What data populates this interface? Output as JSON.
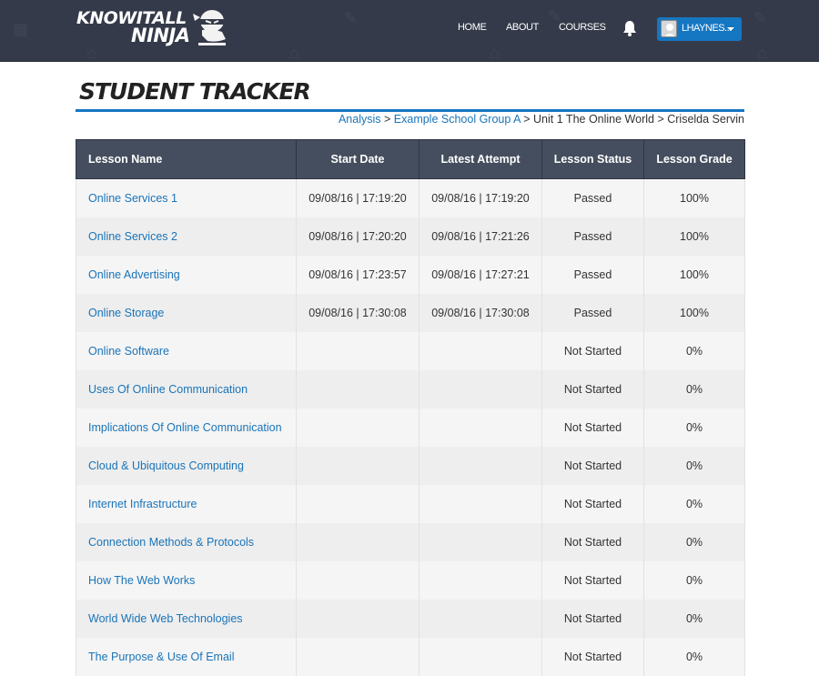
{
  "header": {
    "logo": {
      "line1": "KNOWITALL",
      "line2": "NINJA"
    },
    "nav": [
      {
        "label": "HOME"
      },
      {
        "label": "ABOUT"
      },
      {
        "label": "COURSES"
      }
    ],
    "notifications_icon": "bell-icon",
    "user": {
      "name": "LHAYNES...",
      "avatar_icon": "user-avatar-icon"
    },
    "colors": {
      "bar": "#343a49",
      "accent": "#1576c2"
    }
  },
  "page": {
    "title": "STUDENT TRACKER"
  },
  "breadcrumb": {
    "items": [
      {
        "label": "Analysis",
        "link": true
      },
      {
        "label": "Example School Group A",
        "link": true
      },
      {
        "label": "Unit 1 The Online World",
        "link": false
      },
      {
        "label": "Criselda Servin",
        "link": false
      }
    ],
    "separator": ">"
  },
  "table": {
    "columns": [
      "Lesson Name",
      "Start Date",
      "Latest Attempt",
      "Lesson Status",
      "Lesson Grade"
    ],
    "rows": [
      {
        "lesson": "Online Services 1",
        "start": "09/08/16 | 17:19:20",
        "latest": "09/08/16 | 17:19:20",
        "status": "Passed",
        "grade": "100%"
      },
      {
        "lesson": "Online Services 2",
        "start": "09/08/16 | 17:20:20",
        "latest": "09/08/16 | 17:21:26",
        "status": "Passed",
        "grade": "100%"
      },
      {
        "lesson": "Online Advertising",
        "start": "09/08/16 | 17:23:57",
        "latest": "09/08/16 | 17:27:21",
        "status": "Passed",
        "grade": "100%"
      },
      {
        "lesson": "Online Storage",
        "start": "09/08/16 | 17:30:08",
        "latest": "09/08/16 | 17:30:08",
        "status": "Passed",
        "grade": "100%"
      },
      {
        "lesson": "Online Software",
        "start": "",
        "latest": "",
        "status": "Not Started",
        "grade": "0%"
      },
      {
        "lesson": "Uses Of Online Communication",
        "start": "",
        "latest": "",
        "status": "Not Started",
        "grade": "0%"
      },
      {
        "lesson": "Implications Of Online Communication",
        "start": "",
        "latest": "",
        "status": "Not Started",
        "grade": "0%"
      },
      {
        "lesson": "Cloud & Ubiquitous Computing",
        "start": "",
        "latest": "",
        "status": "Not Started",
        "grade": "0%"
      },
      {
        "lesson": "Internet Infrastructure",
        "start": "",
        "latest": "",
        "status": "Not Started",
        "grade": "0%"
      },
      {
        "lesson": "Connection Methods & Protocols",
        "start": "",
        "latest": "",
        "status": "Not Started",
        "grade": "0%"
      },
      {
        "lesson": "How The Web Works",
        "start": "",
        "latest": "",
        "status": "Not Started",
        "grade": "0%"
      },
      {
        "lesson": "World Wide Web Technologies",
        "start": "",
        "latest": "",
        "status": "Not Started",
        "grade": "0%"
      },
      {
        "lesson": "The Purpose & Use Of Email",
        "start": "",
        "latest": "",
        "status": "Not Started",
        "grade": "0%"
      }
    ]
  }
}
